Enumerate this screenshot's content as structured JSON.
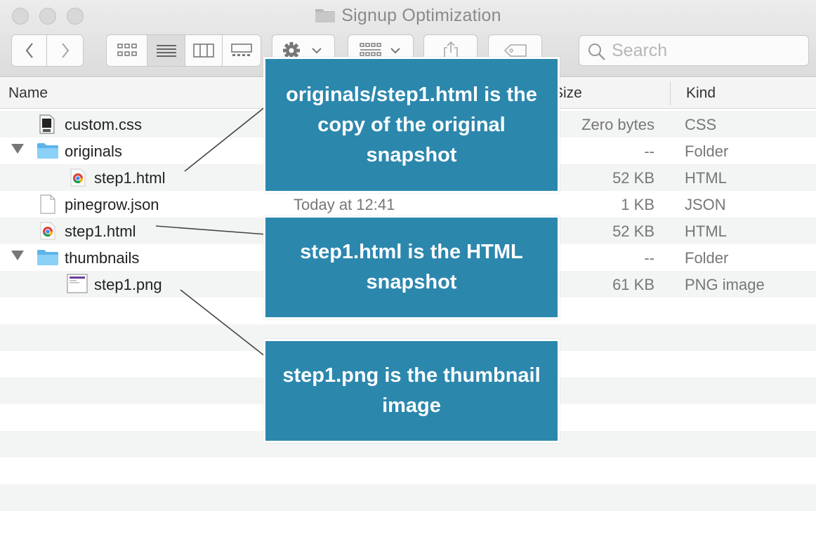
{
  "window": {
    "title": "Signup Optimization"
  },
  "toolbar": {
    "search_placeholder": "Search"
  },
  "columns": {
    "name": "Name",
    "size": "Size",
    "kind": "Kind"
  },
  "files": [
    {
      "name": "custom.css",
      "date": "",
      "size": "Zero bytes",
      "kind": "CSS",
      "icon": "css-file-icon",
      "indent": 0,
      "disclosure": false
    },
    {
      "name": "originals",
      "date": "",
      "size": "--",
      "kind": "Folder",
      "icon": "folder-icon",
      "indent": 0,
      "disclosure": true
    },
    {
      "name": "step1.html",
      "date": "",
      "size": "52 KB",
      "kind": "HTML",
      "icon": "chrome-html-icon",
      "indent": 1,
      "disclosure": false
    },
    {
      "name": "pinegrow.json",
      "date": "Today at 12:41",
      "size": "1 KB",
      "kind": "JSON",
      "icon": "document-icon",
      "indent": 0,
      "disclosure": false
    },
    {
      "name": "step1.html",
      "date": "",
      "size": "52 KB",
      "kind": "HTML",
      "icon": "chrome-html-icon",
      "indent": 0,
      "disclosure": false
    },
    {
      "name": "thumbnails",
      "date": "",
      "size": "--",
      "kind": "Folder",
      "icon": "folder-icon",
      "indent": 0,
      "disclosure": true
    },
    {
      "name": "step1.png",
      "date": "",
      "size": "61 KB",
      "kind": "PNG image",
      "icon": "png-image-icon",
      "indent": 1,
      "disclosure": false
    }
  ],
  "callouts": [
    {
      "text": "originals/step1.html is the copy of the original snapshot"
    },
    {
      "text": "step1.html is the HTML snapshot"
    },
    {
      "text": "step1.png is the thumbnail image"
    }
  ],
  "colors": {
    "callout": "#2c87ad",
    "folder": "#6cc4f4"
  }
}
